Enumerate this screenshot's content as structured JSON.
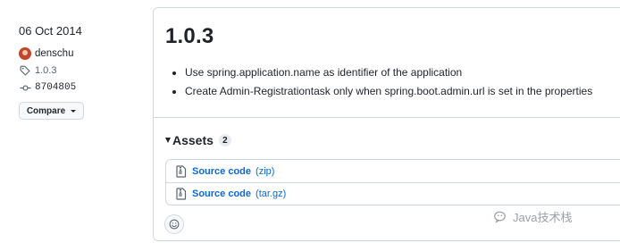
{
  "meta": {
    "date": "06 Oct 2014",
    "author": "denschu",
    "tag": "1.0.3",
    "commit": "8704805",
    "compare_label": "Compare"
  },
  "release": {
    "title": "1.0.3",
    "notes": [
      "Use spring.application.name as identifier of the application",
      "Create Admin-Registrationtask only when spring.boot.admin.url is set in the properties"
    ]
  },
  "assets": {
    "label": "Assets",
    "count": "2",
    "items": [
      {
        "name": "Source code",
        "ext": "(zip)",
        "icon": "file-zip-icon"
      },
      {
        "name": "Source code",
        "ext": "(tar.gz)",
        "icon": "file-zip-icon"
      }
    ]
  },
  "reactions": {
    "icon": "smiley-icon"
  },
  "watermark": {
    "text": "Java技术栈",
    "icon": "wechat-icon"
  },
  "colors": {
    "link": "#0969da",
    "border": "#d1d9e0",
    "text": "#1f2328",
    "muted": "#59636e"
  }
}
